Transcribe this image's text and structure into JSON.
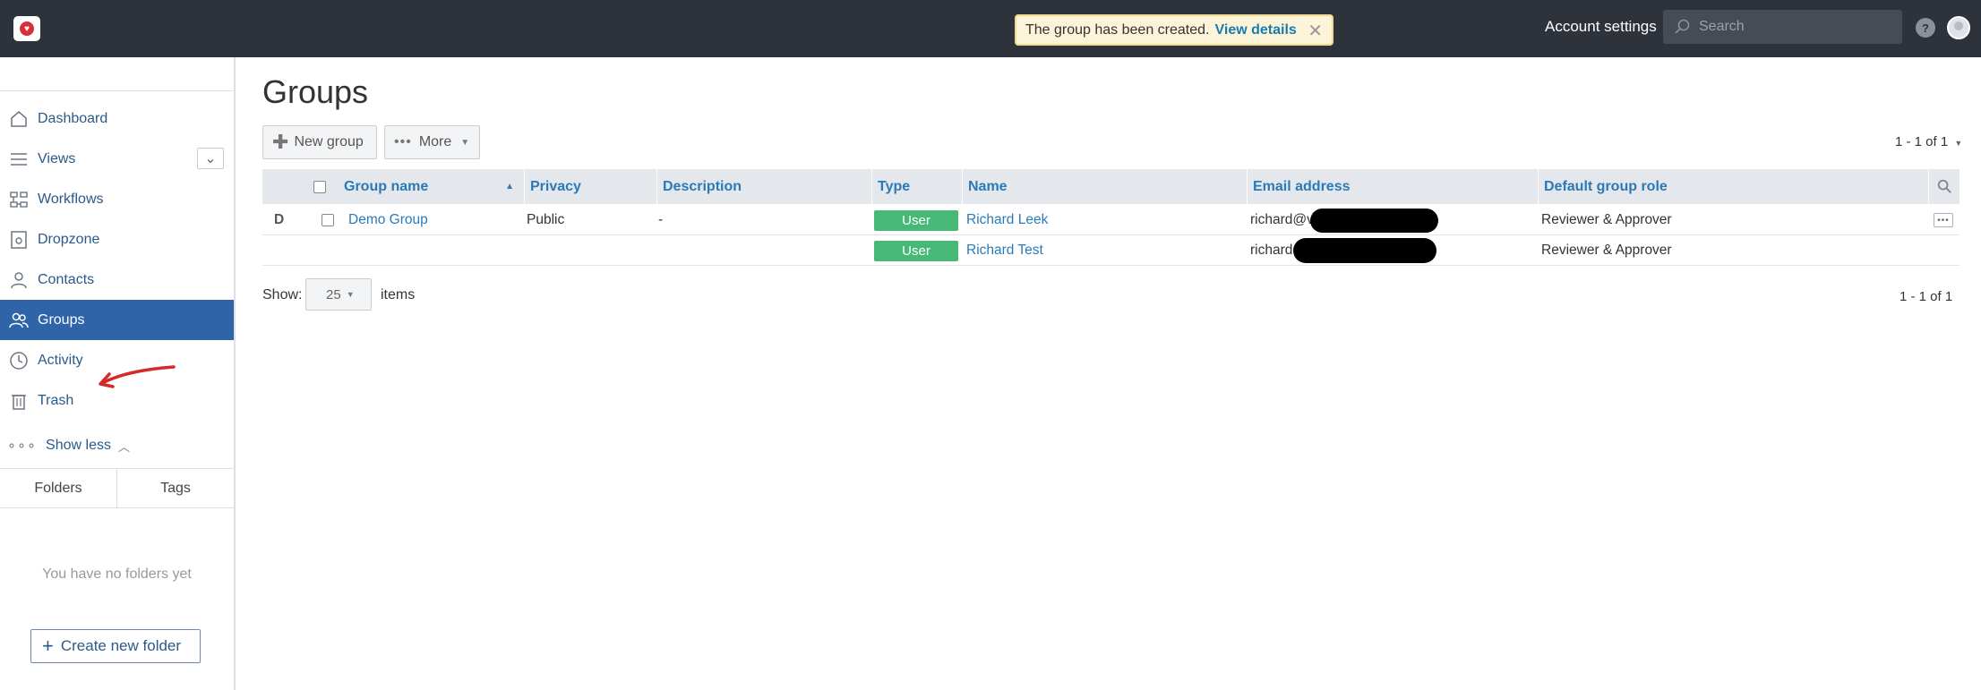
{
  "topbar": {
    "notification_text": "The group has been created.",
    "notification_link": "View details",
    "account_settings": "Account settings",
    "search_placeholder": "Search",
    "help_label": "?"
  },
  "sidebar": {
    "items": [
      {
        "label": "Dashboard",
        "icon": "home-icon"
      },
      {
        "label": "Views",
        "icon": "list-icon"
      },
      {
        "label": "Workflows",
        "icon": "workflow-icon"
      },
      {
        "label": "Dropzone",
        "icon": "dropzone-icon"
      },
      {
        "label": "Contacts",
        "icon": "person-icon"
      },
      {
        "label": "Groups",
        "icon": "people-icon",
        "active": true
      },
      {
        "label": "Activity",
        "icon": "clock-icon"
      },
      {
        "label": "Trash",
        "icon": "trash-icon"
      }
    ],
    "show_less": "Show less",
    "tabs": [
      "Folders",
      "Tags"
    ],
    "empty_folders": "You have no folders yet",
    "create_folder": "Create new folder"
  },
  "main": {
    "title": "Groups",
    "new_group": "New group",
    "more": "More",
    "pager": "1 - 1 of 1",
    "columns": [
      "Group name",
      "Privacy",
      "Description",
      "Type",
      "Name",
      "Email address",
      "Default group role"
    ],
    "row_letter": "D",
    "group": {
      "name": "Demo Group",
      "privacy": "Public",
      "description": "-"
    },
    "members": [
      {
        "type": "User",
        "name": "Richard Leek",
        "email": "richard@v",
        "role": "Reviewer & Approver"
      },
      {
        "type": "User",
        "name": "Richard Test",
        "email": "richard",
        "role": "Reviewer & Approver"
      }
    ],
    "show_label": "Show:",
    "page_size": "25",
    "items_label": "items",
    "pager_bottom": "1 - 1 of 1"
  },
  "colors": {
    "topbar": "#2e323a",
    "active_nav": "#2f65a8",
    "link": "#2a7ab8",
    "user_badge": "#48b876",
    "toast_bg": "#fcf4d8"
  }
}
